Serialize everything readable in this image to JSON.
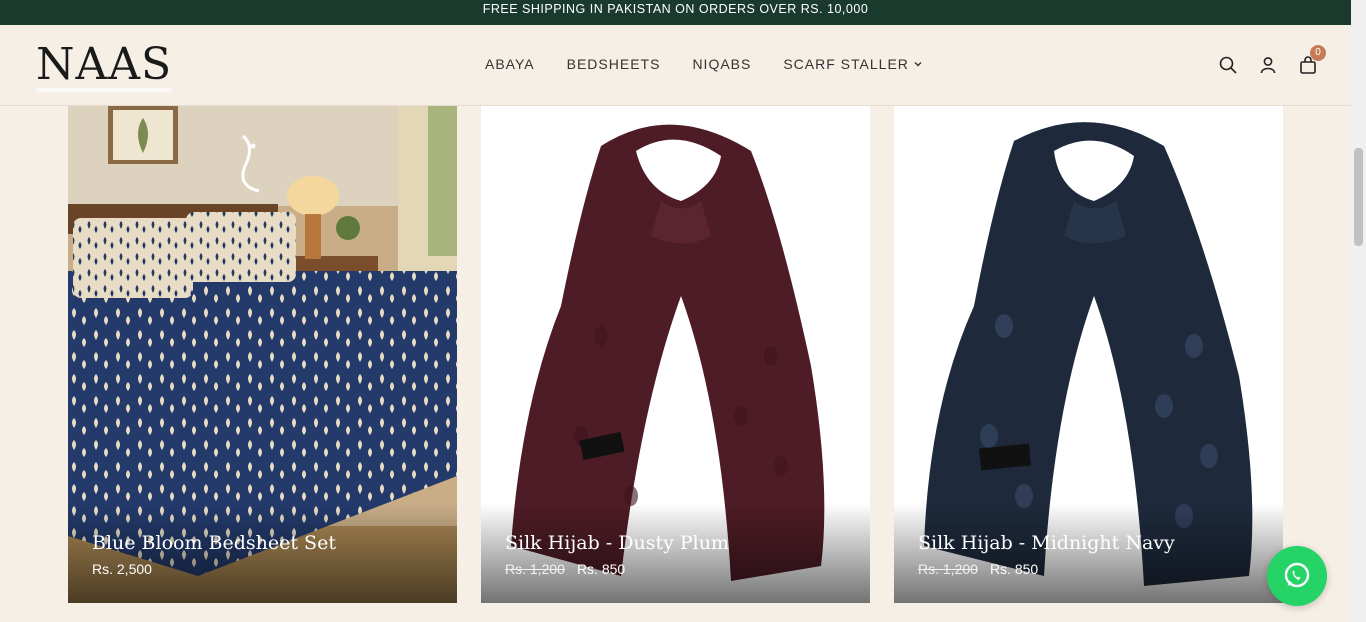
{
  "announcement": "FREE SHIPPING IN PAKISTAN ON ORDERS OVER RS. 10,000",
  "brand": {
    "logo_text": "NAAS"
  },
  "nav": [
    {
      "label": "ABAYA"
    },
    {
      "label": "BEDSHEETS"
    },
    {
      "label": "NIQABS"
    },
    {
      "label": "SCARF STALLER",
      "has_dropdown": true
    }
  ],
  "header_icons": {
    "search": "search-icon",
    "account": "user-icon",
    "cart": "shopping-bag-icon",
    "cart_count": "0"
  },
  "products": [
    {
      "title": "Blue Bloom Bedsheet Set",
      "price": "Rs. 2,500",
      "image": "bedsheet-photo"
    },
    {
      "title": "Silk Hijab - Dusty Plum",
      "compare_price": "Rs. 1,200",
      "price": "Rs. 850",
      "image": "plum-scarf-photo"
    },
    {
      "title": "Silk Hijab - Midnight Navy",
      "compare_price": "Rs. 1,200",
      "price": "Rs. 850",
      "image": "navy-scarf-photo"
    }
  ],
  "colors": {
    "announcement_bg": "#1b3a2e",
    "page_bg": "#f5efe6",
    "badge": "#c77b56",
    "whatsapp": "#25d366",
    "plum": "#4e1c26",
    "navy": "#1e2a3c"
  }
}
